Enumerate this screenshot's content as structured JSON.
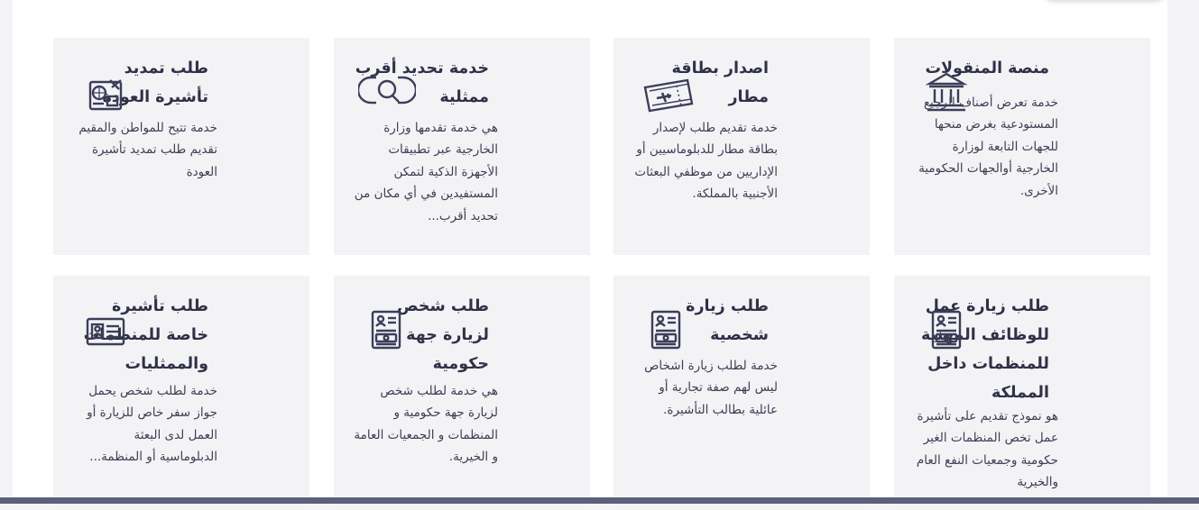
{
  "colors": {
    "card_background": "#f3f3f6",
    "title": "#2f3147",
    "text": "#3c3e52",
    "icon": "#3c3e59",
    "bottom_bar": "#5e5f7a"
  },
  "services": [
    {
      "title": "منصة المنقولات",
      "description": "خدمة تعرض أصناف الرجيع المستودعية بغرض منحها للجهات التابعة لوزارة الخارجية أوالجهات الحكومية الأخرى.",
      "icon": "building-columns-icon"
    },
    {
      "title": "اصدار بطاقة مطار",
      "description": "خدمة تقديم طلب لإصدار بطاقة مطار للدبلوماسيين أو الإداريين من موظفي البعثات الأجنبية بالمملكة.",
      "icon": "airport-ticket-icon"
    },
    {
      "title": "خدمة تحديد أقرب ممثلية",
      "description": "هي خدمة تقدمها وزارة الخارجية عبر تطبيقات الأجهزة الذكية لتمكن المستفيدين في أي مكان من تحديد أقرب...",
      "icon": "location-search-icon"
    },
    {
      "title": "طلب تمديد تأشيرة العودة",
      "description": "خدمة تتيح للمواطن والمقيم تقديم طلب تمديد تأشيرة العودة",
      "icon": "passport-travel-icon"
    },
    {
      "title": "طلب زيارة عمل للوظائف المهنية للمنظمات داخل المملكة",
      "description": "هو نموذج تقديم على تأشيرة عمل تخص المنظمات الغير حكومية وجمعيات النفع العام والخيرية",
      "icon": "id-document-icon"
    },
    {
      "title": "طلب زيارة شخصية",
      "description": "خدمة لطلب زيارة اشخاص ليس لهم صفة تجارية أو عائلية بطالب التأشيرة.",
      "icon": "id-document-icon"
    },
    {
      "title": "طلب شخص لزيارة جهة حكومية",
      "description": "هي خدمة لطلب شخص لزيارة جهة حكومية و المنظمات و الجمعيات العامة و الخيرية.",
      "icon": "id-document-icon"
    },
    {
      "title": "طلب تأشيرة خاصة للمنظمات والممثليات",
      "description": "خدمة لطلب شخص يحمل جواز سفر خاص للزيارة أو العمل لدى البعثة الدبلوماسية أو المنظمة...",
      "icon": "id-card-icon"
    }
  ]
}
